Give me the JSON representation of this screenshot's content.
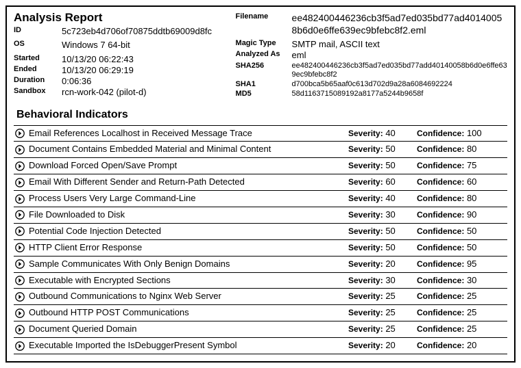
{
  "header": {
    "title": "Analysis Report",
    "left": {
      "id_label": "ID",
      "id_value": "5c723eb4d706of70875ddtb69009d8fc",
      "os_label": "OS",
      "os_value": "Windows 7 64-bit",
      "started_label": "Started",
      "started_value": "10/13/20 06:22:43",
      "ended_label": "Ended",
      "ended_value": "10/13/20 06:29:19",
      "duration_label": "Duration",
      "duration_value": "0:06:36",
      "sandbox_label": "Sandbox",
      "sandbox_value": "rcn-work-042 (pilot-d)"
    },
    "right": {
      "filename_label": "Filename",
      "filename_value": "ee482400446236cb3f5ad7ed035bd77ad40140058b6d0e6ffe639ec9bfebc8f2.eml",
      "magic_label": "Magic Type",
      "magic_value": "SMTP mail, ASCII text",
      "analyzed_label": "Analyzed As",
      "analyzed_value": "eml",
      "sha256_label": "SHA256",
      "sha256_value": "ee482400446236cb3f5ad7ed035bd77add40140058b6d0e6ffe639ec9bfebc8f2",
      "sha1_label": "SHA1",
      "sha1_value": "d700bca5b65aaf0c613d702d9a28a6084692224",
      "md5_label": "MD5",
      "md5_value": "58d1163715089192a8177a5244b9658f"
    }
  },
  "indicators_title": "Behavioral Indicators",
  "labels": {
    "severity": "Severity:",
    "confidence": "Confidence:"
  },
  "indicators": [
    {
      "name": "Email References Localhost in Received Message Trace",
      "severity": "40",
      "confidence": "100"
    },
    {
      "name": "Document Contains Embedded Material and Minimal Content",
      "severity": "50",
      "confidence": "80"
    },
    {
      "name": "Download Forced Open/Save Prompt",
      "severity": "50",
      "confidence": "75"
    },
    {
      "name": "Email With Different Sender and Return-Path Detected",
      "severity": "60",
      "confidence": "60"
    },
    {
      "name": "Process Users Very Large Command-Line",
      "severity": "40",
      "confidence": "80"
    },
    {
      "name": "File Downloaded to Disk",
      "severity": "30",
      "confidence": "90"
    },
    {
      "name": "Potential Code Injection Detected",
      "severity": "50",
      "confidence": "50"
    },
    {
      "name": "HTTP Client Error Response",
      "severity": "50",
      "confidence": "50"
    },
    {
      "name": "Sample Communicates With Only Benign Domains",
      "severity": "20",
      "confidence": "95"
    },
    {
      "name": "Executable with Encrypted Sections",
      "severity": "30",
      "confidence": "30"
    },
    {
      "name": "Outbound Communications to Nginx Web Server",
      "severity": "25",
      "confidence": "25"
    },
    {
      "name": "Outbound HTTP POST Communications",
      "severity": "25",
      "confidence": "25"
    },
    {
      "name": "Document Queried Domain",
      "severity": "25",
      "confidence": "25"
    },
    {
      "name": "Executable Imported the IsDebuggerPresent Symbol",
      "severity": "20",
      "confidence": "20"
    }
  ]
}
